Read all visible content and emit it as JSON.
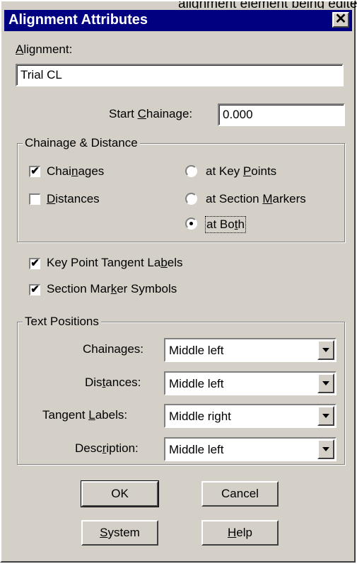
{
  "window": {
    "bleed_text": "alignment element being edited in the Alignment Manager.",
    "title": "Alignment Attributes",
    "close_glyph": "✕"
  },
  "alignment": {
    "label_prefix": "",
    "label_mnemonic": "A",
    "label_rest": "lignment:",
    "value": "Trial CL"
  },
  "start_chainage": {
    "label_prefix": "Start ",
    "label_mnemonic": "C",
    "label_rest": "hainage:",
    "value": "0.000"
  },
  "chainage_distance": {
    "group_title": "Chainage & Distance",
    "chainages": {
      "pre": "Chai",
      "mn": "n",
      "post": "ages",
      "checked": true
    },
    "distances": {
      "pre": "",
      "mn": "D",
      "post": "istances",
      "checked": false
    },
    "key_points": {
      "pre": "at Key ",
      "mn": "P",
      "post": "oints",
      "selected": false
    },
    "section_markers": {
      "pre": "at Section ",
      "mn": "M",
      "post": "arkers",
      "selected": false
    },
    "both": {
      "pre": "at Bo",
      "mn": "t",
      "post": "h",
      "selected": true
    }
  },
  "options": {
    "key_point_tangent": {
      "pre": "Key Point Tangent La",
      "mn": "b",
      "post": "els",
      "checked": true
    },
    "section_marker_symbols": {
      "pre": "Section Mar",
      "mn": "k",
      "post": "er Symbols",
      "checked": true
    }
  },
  "text_positions": {
    "group_title": "Text Positions",
    "chainages": {
      "pre": "Chainages:",
      "mn": "",
      "post": "",
      "value": "Middle left"
    },
    "distances": {
      "pre": "Dis",
      "mn": "t",
      "post": "ances:",
      "value": "Middle left"
    },
    "tangent_labels": {
      "pre": "Tangent ",
      "mn": "L",
      "post": "abels:",
      "value": "Middle right"
    },
    "description": {
      "pre": "Desc",
      "mn": "r",
      "post": "iption:",
      "value": "Middle left"
    }
  },
  "buttons": {
    "ok": "OK",
    "cancel": "Cancel",
    "system": {
      "pre": "",
      "mn": "S",
      "post": "ystem"
    },
    "help": {
      "pre": "",
      "mn": "H",
      "post": "elp"
    }
  },
  "glyphs": {
    "check": "✔"
  }
}
